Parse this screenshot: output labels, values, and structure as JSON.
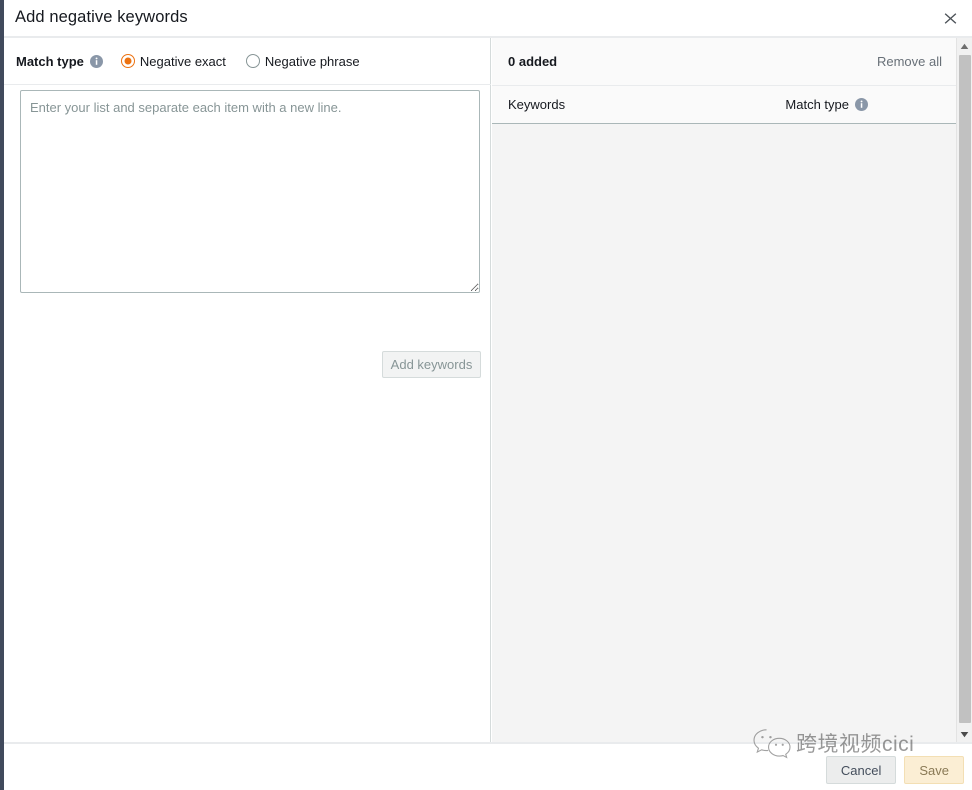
{
  "modal": {
    "title": "Add negative keywords",
    "close_label": "×"
  },
  "left_panel": {
    "match_type_label": "Match type",
    "info_icon": "info-icon",
    "radios": [
      {
        "label": "Negative exact",
        "selected": true
      },
      {
        "label": "Negative phrase",
        "selected": false
      }
    ],
    "textarea": {
      "placeholder": "Enter your list and separate each item with a new line.",
      "value": ""
    },
    "add_keywords_label": "Add keywords"
  },
  "right_panel": {
    "added_count_label": "0 added",
    "remove_all_label": "Remove all",
    "columns": {
      "keywords": "Keywords",
      "match_type": "Match type"
    },
    "rows": []
  },
  "footer": {
    "cancel_label": "Cancel",
    "save_label": "Save"
  },
  "watermark": {
    "text": "跨境视频cici",
    "logo": "wechat-logo"
  },
  "colors": {
    "accent_orange": "#ec7211",
    "rail_navy": "#414a5c",
    "save_bg": "#fbeed4",
    "cancel_bg": "#eceded",
    "panel_gray": "#f4f4f4"
  }
}
